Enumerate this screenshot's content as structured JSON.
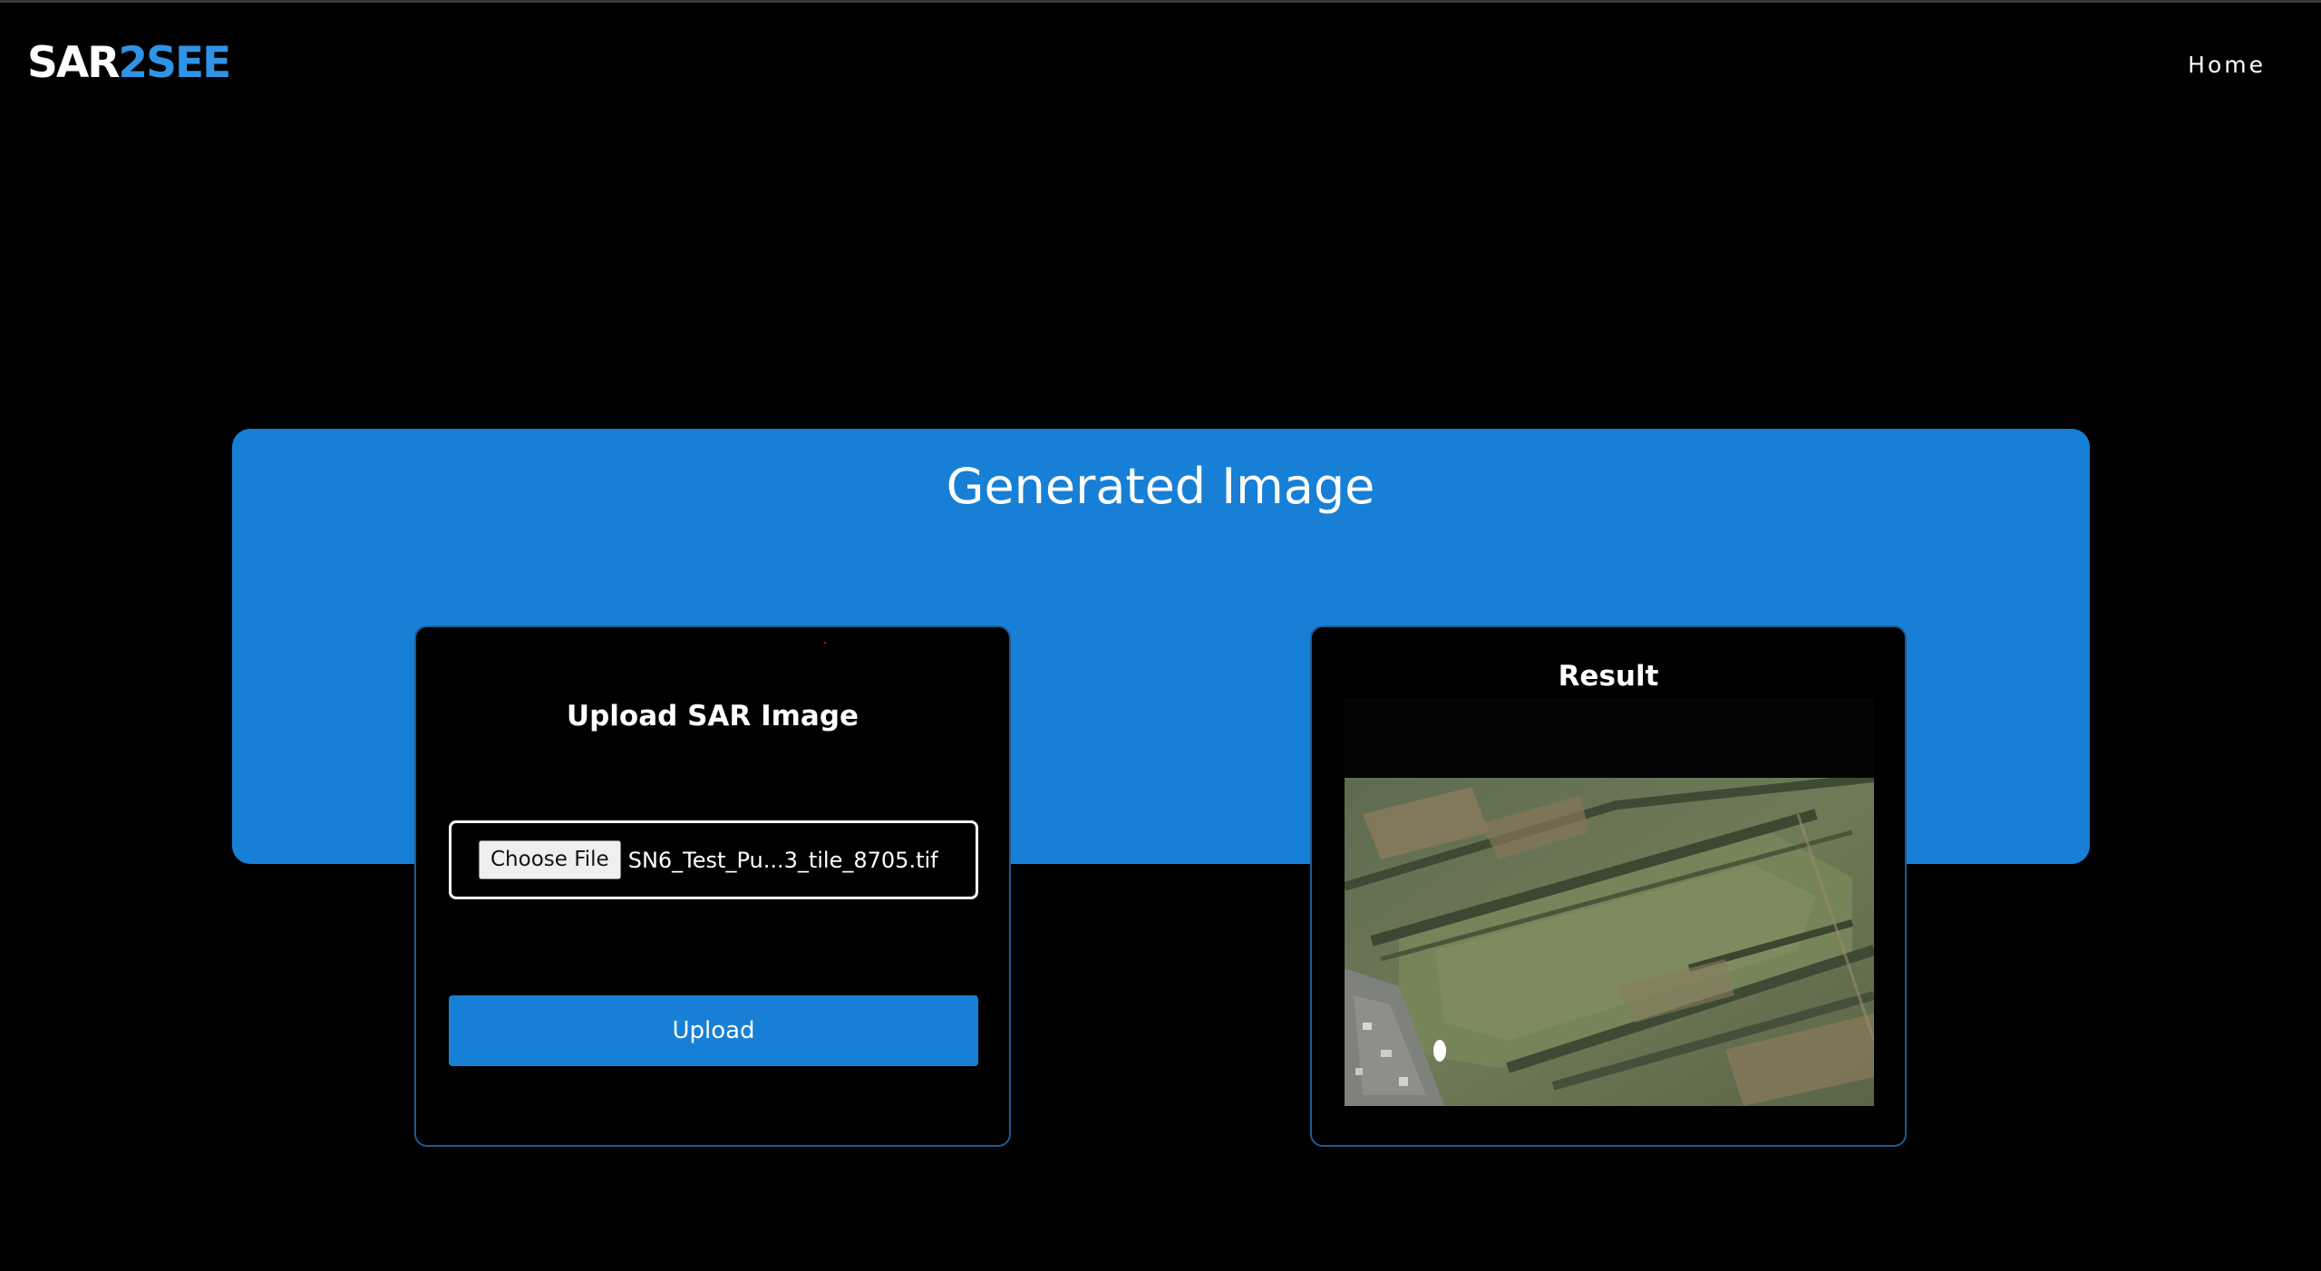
{
  "header": {
    "logo_part1": "SAR",
    "logo_part2": "2SEE",
    "nav_home": "Home"
  },
  "hero": {
    "title": "Generated Image"
  },
  "upload_card": {
    "title": "Upload SAR Image",
    "choose_file_label": "Choose File",
    "file_name": "SN6_Test_Pu...3_tile_8705.tif",
    "upload_label": "Upload"
  },
  "result_card": {
    "title": "Result",
    "image_content": "aerial optical image of green fields and tree rows"
  },
  "colors": {
    "background": "#000000",
    "accent_blue": "#1780d6",
    "logo_blue": "#2f93e6",
    "card_border": "#1d5b94",
    "text": "#ffffff"
  }
}
